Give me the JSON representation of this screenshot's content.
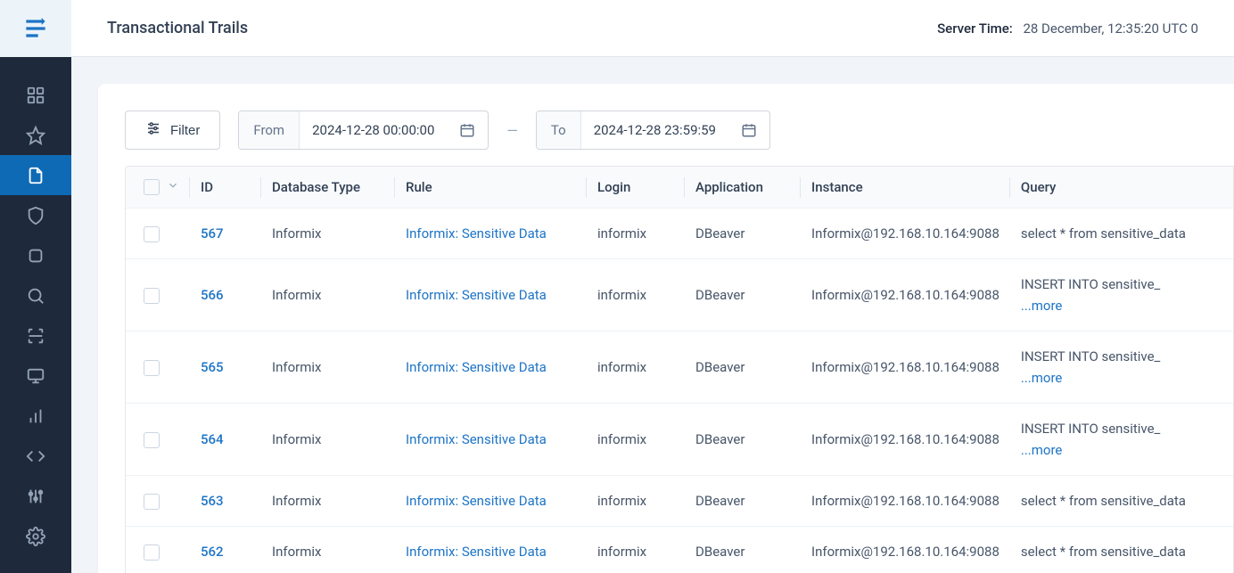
{
  "header": {
    "title": "Transactional Trails",
    "server_time_label": "Server Time:",
    "server_time_value": "28 December, 12:35:20  UTC 0"
  },
  "filters": {
    "filter_label": "Filter",
    "from_label": "From",
    "from_value": "2024-12-28 00:00:00",
    "separator": "—",
    "to_label": "To",
    "to_value": "2024-12-28 23:59:59"
  },
  "table": {
    "headers": {
      "id": "ID",
      "dbtype": "Database Type",
      "rule": "Rule",
      "login": "Login",
      "application": "Application",
      "instance": "Instance",
      "query": "Query"
    },
    "more_label": "...more",
    "rows": [
      {
        "id": "567",
        "dbtype": "Informix",
        "rule": "Informix: Sensitive Data",
        "login": "informix",
        "application": "DBeaver",
        "instance": "Informix@192.168.10.164:9088",
        "query": "select * from sensitive_data",
        "has_more": false
      },
      {
        "id": "566",
        "dbtype": "Informix",
        "rule": "Informix: Sensitive Data",
        "login": "informix",
        "application": "DBeaver",
        "instance": "Informix@192.168.10.164:9088",
        "query": "INSERT INTO sensitive_",
        "has_more": true
      },
      {
        "id": "565",
        "dbtype": "Informix",
        "rule": "Informix: Sensitive Data",
        "login": "informix",
        "application": "DBeaver",
        "instance": "Informix@192.168.10.164:9088",
        "query": "INSERT INTO sensitive_",
        "has_more": true
      },
      {
        "id": "564",
        "dbtype": "Informix",
        "rule": "Informix: Sensitive Data",
        "login": "informix",
        "application": "DBeaver",
        "instance": "Informix@192.168.10.164:9088",
        "query": "INSERT INTO sensitive_",
        "has_more": true
      },
      {
        "id": "563",
        "dbtype": "Informix",
        "rule": "Informix: Sensitive Data",
        "login": "informix",
        "application": "DBeaver",
        "instance": "Informix@192.168.10.164:9088",
        "query": "select * from sensitive_data",
        "has_more": false
      },
      {
        "id": "562",
        "dbtype": "Informix",
        "rule": "Informix: Sensitive Data",
        "login": "informix",
        "application": "DBeaver",
        "instance": "Informix@192.168.10.164:9088",
        "query": "select * from sensitive_data",
        "has_more": false
      }
    ]
  },
  "sidebar": {
    "items": [
      {
        "name": "dashboard-icon",
        "active": false
      },
      {
        "name": "star-icon",
        "active": false
      },
      {
        "name": "file-icon",
        "active": true
      },
      {
        "name": "shield-icon",
        "active": false
      },
      {
        "name": "layers-icon",
        "active": false
      },
      {
        "name": "search-icon",
        "active": false
      },
      {
        "name": "scan-icon",
        "active": false
      },
      {
        "name": "monitor-icon",
        "active": false
      },
      {
        "name": "chart-icon",
        "active": false
      },
      {
        "name": "code-icon",
        "active": false
      },
      {
        "name": "sliders-icon",
        "active": false
      },
      {
        "name": "gear-icon",
        "active": false
      }
    ]
  }
}
